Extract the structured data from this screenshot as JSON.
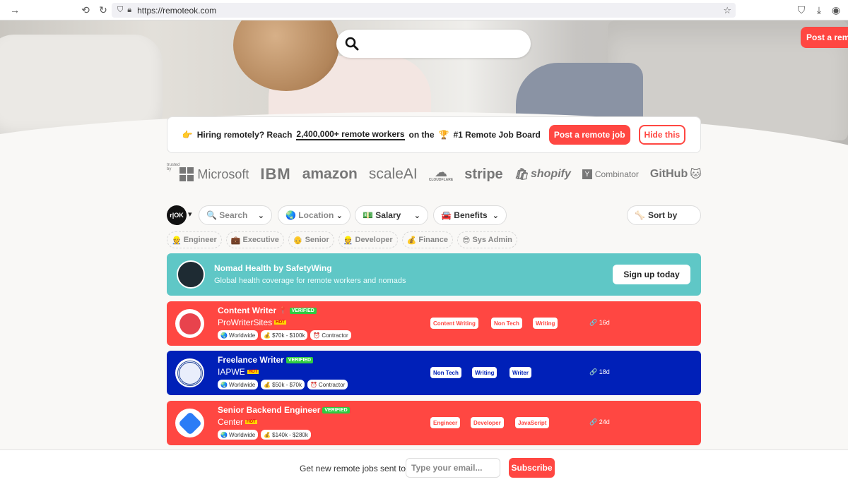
{
  "browser": {
    "url": "https://remoteok.com"
  },
  "header": {
    "post_button": "Post a remote job"
  },
  "banner": {
    "lead": "Hiring remotely? Reach",
    "highlight": "2,400,000+ remote workers",
    "tail": "on the",
    "rank": "#1 Remote Job Board",
    "post_button": "Post a remote job",
    "hide_button": "Hide this"
  },
  "trusted": {
    "label": "trusted by",
    "logos": [
      "Microsoft",
      "IBM",
      "amazon",
      "scaleAI",
      "CLOUDFLARE",
      "stripe",
      "shopify",
      "Combinator",
      "GitHub"
    ]
  },
  "filters": {
    "logo": "r|OK",
    "search": "Search",
    "location": "Location",
    "salary": "Salary",
    "benefits": "Benefits",
    "sort": "Sort by"
  },
  "quick_tags": [
    "Engineer",
    "Executive",
    "Senior",
    "Developer",
    "Finance",
    "Sys Admin"
  ],
  "promo": {
    "title": "Nomad Health by SafetyWing",
    "subtitle": "Global health coverage for remote workers and nomads",
    "button": "Sign up today"
  },
  "jobs": [
    {
      "title": "Content Writer",
      "verified": "VERIFIED",
      "company": "ProWriterSites",
      "hot": "HOT",
      "location": "Worldwide",
      "salary": "$70k - $100k",
      "type": "Contractor",
      "tags": [
        "Content Writing",
        "Non Tech",
        "Writing"
      ],
      "age": "16d",
      "color": "#ff4742"
    },
    {
      "title": "Freelance Writer",
      "verified": "VERIFIED",
      "company": "IAPWE",
      "hot": "HOT",
      "location": "Worldwide",
      "salary": "$50k - $70k",
      "type": "Contractor",
      "tags": [
        "Non Tech",
        "Writing",
        "Writer"
      ],
      "age": "18d",
      "color": "#0020b8"
    },
    {
      "title": "Senior Backend Engineer",
      "verified": "VERIFIED",
      "company": "Center",
      "hot": "HOT",
      "location": "Worldwide",
      "salary": "$140k - $280k",
      "tags": [
        "Engineer",
        "Developer",
        "JavaScript"
      ],
      "age": "24d",
      "color": "#ff4742"
    }
  ],
  "footer": {
    "text": "Get new remote jobs sent to",
    "email_placeholder": "Type your email...",
    "subscribe": "Subscribe"
  }
}
